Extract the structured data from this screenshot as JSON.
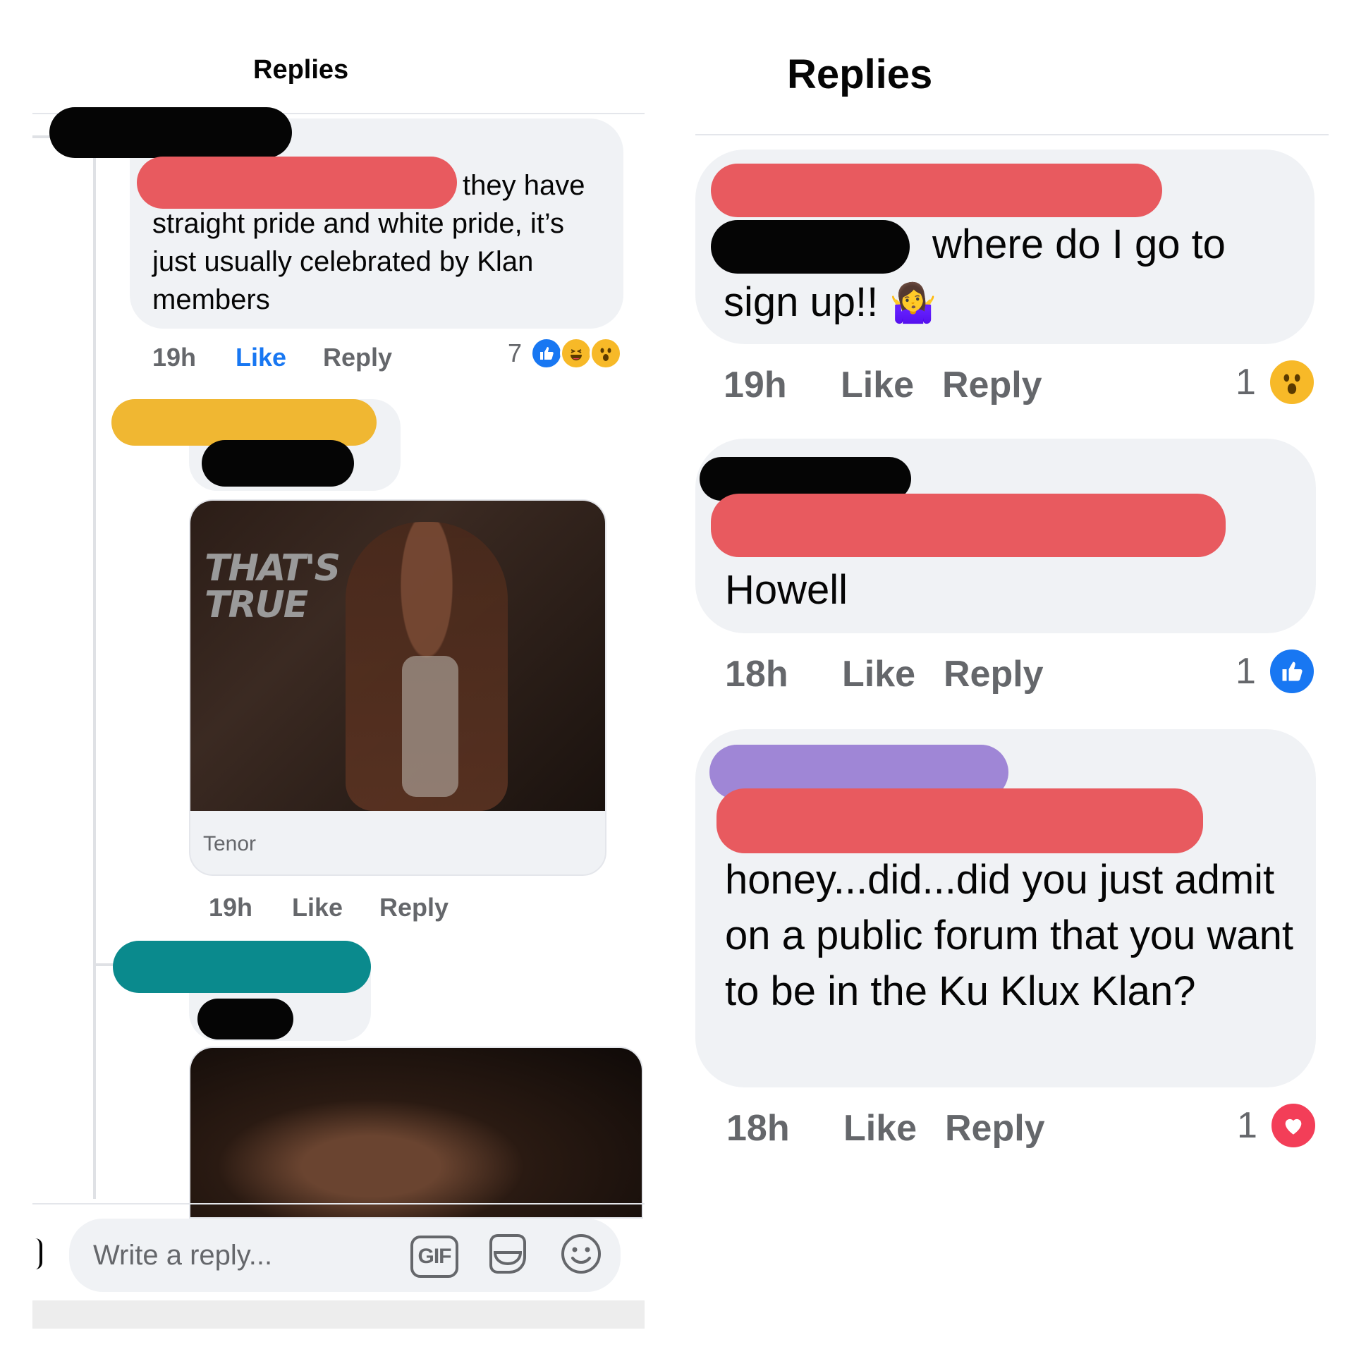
{
  "left_panel": {
    "title": "Replies",
    "comment1": {
      "text_tail": "they have",
      "text_rest": "straight pride and white pride, it’s just usually celebrated by Klan members",
      "time": "19h",
      "like_label": "Like",
      "reply_label": "Reply",
      "reaction_count": "7",
      "reactions": [
        "like-icon",
        "haha-icon",
        "wow-icon"
      ]
    },
    "comment2": {
      "gif_caption": "THAT'S TRUE",
      "gif_source": "Tenor",
      "time": "19h",
      "like_label": "Like",
      "reply_label": "Reply"
    },
    "composer": {
      "placeholder": "Write a reply...",
      "gif_label": "GIF"
    }
  },
  "right_panel": {
    "title": "Replies",
    "comment1": {
      "text_tail": "where do I go to",
      "text_line2": "sign up!!",
      "emoji": "🤷‍♀️",
      "time": "19h",
      "like_label": "Like",
      "reply_label": "Reply",
      "reaction_count": "1",
      "reaction": "wow-icon"
    },
    "comment2": {
      "text": "Howell",
      "time": "18h",
      "like_label": "Like",
      "reply_label": "Reply",
      "reaction_count": "1",
      "reaction": "like-icon"
    },
    "comment3": {
      "text": "honey...did...did you just admit on a public forum that you want to be in the Ku Klux Klan?",
      "time": "18h",
      "like_label": "Like",
      "reply_label": "Reply",
      "reaction_count": "1",
      "reaction": "love-icon"
    }
  },
  "colors": {
    "like_blue": "#1877f2",
    "meta_gray": "#65676b",
    "bubble_gray": "#f0f2f5",
    "redaction_red": "#e85a5f",
    "redaction_yellow": "#f0b732",
    "redaction_teal": "#0a8a8d",
    "redaction_purple": "#9f86d6"
  }
}
